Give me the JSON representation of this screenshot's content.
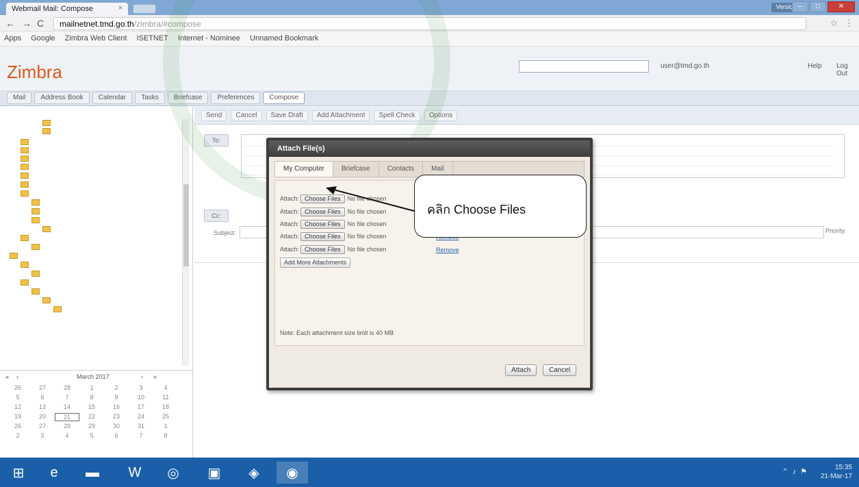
{
  "browser": {
    "tab_title": "Webmail Mail: Compose",
    "url_host": "mailnetnet.tmd.go.th",
    "url_path": "/zimbra/#compose",
    "user_badge": "Version 1",
    "bookmarks": [
      "Apps",
      "Google",
      "Zimbra Web Client",
      "ISETNET",
      "Internet - Nominee",
      "Unnamed Bookmark"
    ]
  },
  "zimbra": {
    "logo": "Zimbra",
    "user_email": "user@tmd.go.th",
    "help": "Help",
    "logout": "Log Out",
    "app_tabs": [
      "Mail",
      "Address Book",
      "Calendar",
      "Tasks",
      "Briefcase",
      "Preferences",
      "Compose"
    ]
  },
  "left_panel": {
    "calendar_month": "March 2017",
    "calendar_days": [
      "26",
      "27",
      "28",
      "1",
      "2",
      "3",
      "4",
      "5",
      "6",
      "7",
      "8",
      "9",
      "10",
      "11",
      "12",
      "13",
      "14",
      "15",
      "16",
      "17",
      "18",
      "19",
      "20",
      "21",
      "22",
      "23",
      "24",
      "25",
      "26",
      "27",
      "28",
      "29",
      "30",
      "31",
      "1",
      "2",
      "3",
      "4",
      "5",
      "6",
      "7",
      "8"
    ]
  },
  "compose": {
    "toolbar": [
      "Send",
      "Cancel",
      "Save Draft",
      "Add Attachment",
      "Spell Check",
      "Options"
    ],
    "to_label": "To:",
    "cc_label": "Cc:",
    "subject_label": "Subject:",
    "priority_label": "Priority:"
  },
  "dialog": {
    "title": "Attach File(s)",
    "tabs": [
      "My Computer",
      "Briefcase",
      "Contacts",
      "Mail"
    ],
    "attach_label": "Attach:",
    "choose_files": "Choose Files",
    "no_file": "No file chosen",
    "remove": "Remove",
    "add_more": "Add More Attachments",
    "note": "Note: Each attachment size limit is 40 MB",
    "attach_button": "Attach",
    "cancel_button": "Cancel"
  },
  "callout": {
    "text": "คลิก Choose Files"
  },
  "taskbar": {
    "time": "15:35",
    "date": "21-Mar-17"
  },
  "colors": {
    "zimbra_orange": "#e0571a",
    "taskbar_blue": "#1b5fa8",
    "dialog_title": "#3d3d3d"
  }
}
